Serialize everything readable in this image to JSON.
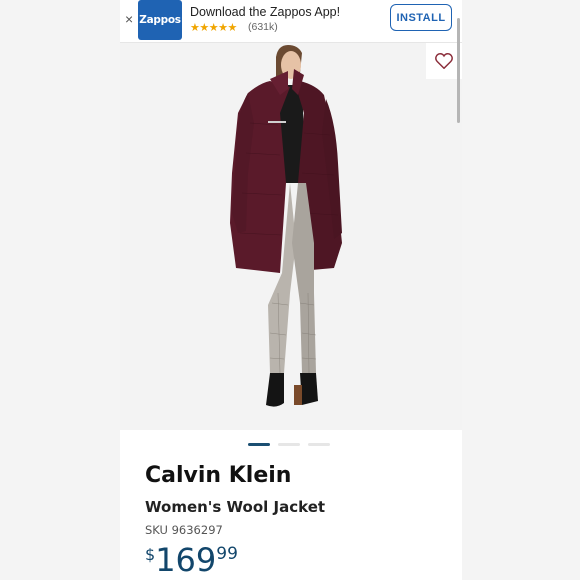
{
  "banner": {
    "close_glyph": "×",
    "app_logo_text": "Zappos",
    "title": "Download the Zappos App!",
    "stars": "★★★★★",
    "rating_count": "(631k)",
    "install_label": "INSTALL"
  },
  "product": {
    "brand": "Calvin Klein",
    "name": "Women's Wool Jacket",
    "sku": "SKU 9636297",
    "price_currency": "$",
    "price_dollars": "169",
    "price_cents": "99"
  },
  "gallery": {
    "image_count": 3,
    "active_index": 0
  },
  "colors": {
    "brand_blue": "#1f63b3",
    "price_color": "#12466b",
    "coat_color": "#5a1a2a",
    "heart_color": "#8b2d3a"
  },
  "icons": {
    "close": "close-icon",
    "heart": "heart-icon",
    "stars": "star-icon"
  }
}
